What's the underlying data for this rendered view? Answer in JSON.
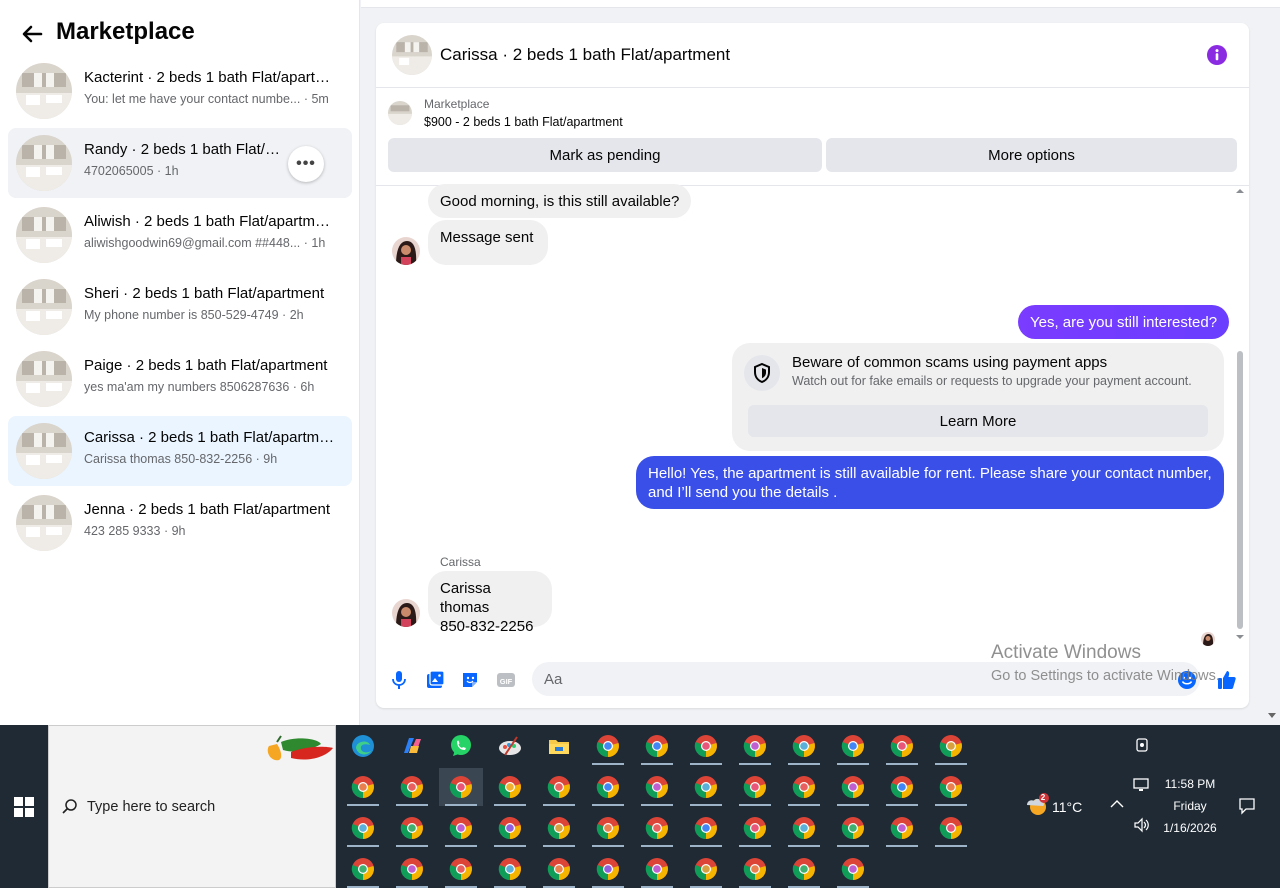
{
  "sidebar": {
    "title": "Marketplace",
    "conversations": [
      {
        "title": "Kacterint · 2 beds 1 bath Flat/apart…",
        "preview": "You: let me have your contact numbe...",
        "time": "5m"
      },
      {
        "title": "Randy · 2 beds 1 bath Flat/apart…",
        "preview": "4702065005",
        "time": "1h"
      },
      {
        "title": "Aliwish · 2 beds 1 bath Flat/apartm…",
        "preview": "aliwishgoodwin69@gmail.com ##448...",
        "time": "1h"
      },
      {
        "title": "Sheri · 2 beds 1 bath Flat/apartment",
        "preview": "My phone number is 850-529-4749",
        "time": "2h"
      },
      {
        "title": "Paige · 2 beds 1 bath Flat/apartment",
        "preview": "yes ma'am my numbers 8506287636",
        "time": "6h"
      },
      {
        "title": "Carissa · 2 beds 1 bath Flat/apartm…",
        "preview": "Carissa thomas 850-832-2256",
        "time": "9h"
      },
      {
        "title": "Jenna · 2 beds 1 bath Flat/apartment",
        "preview": "423 285 9333",
        "time": "9h"
      }
    ]
  },
  "chat": {
    "title": "Carissa · 2 beds 1 bath Flat/apartment",
    "listing_label": "Marketplace",
    "listing_price": "$900 - 2 beds 1 bath Flat/apartment",
    "mark_pending": "Mark as pending",
    "more_options": "More options",
    "messages": {
      "m1": "Good morning, is this still available?",
      "m2": "Message sent",
      "m3": "Yes, are you still interested?",
      "m4": "Hello! Yes, the apartment is still available for rent. Please share your contact number, and I’ll send you the details .",
      "m5_line1": "Carissa thomas",
      "m5_line2": "850-832-2256"
    },
    "sender_name": "Carissa",
    "scam": {
      "title": "Beware of common scams using payment apps",
      "body": "Watch out for fake emails or requests to upgrade your payment account.",
      "button": "Learn More"
    },
    "composer_placeholder": "Aa",
    "accent": "#0a7cff",
    "info_color": "#8a2be2"
  },
  "watermark": {
    "line1": "Activate Windows",
    "line2": "Go to Settings to activate Windows."
  },
  "taskbar": {
    "search_placeholder": "Type here to search",
    "temperature": "11°C",
    "weather_badge": "2",
    "time": "11:58 PM",
    "day": "Friday",
    "date": "1/16/2026"
  }
}
